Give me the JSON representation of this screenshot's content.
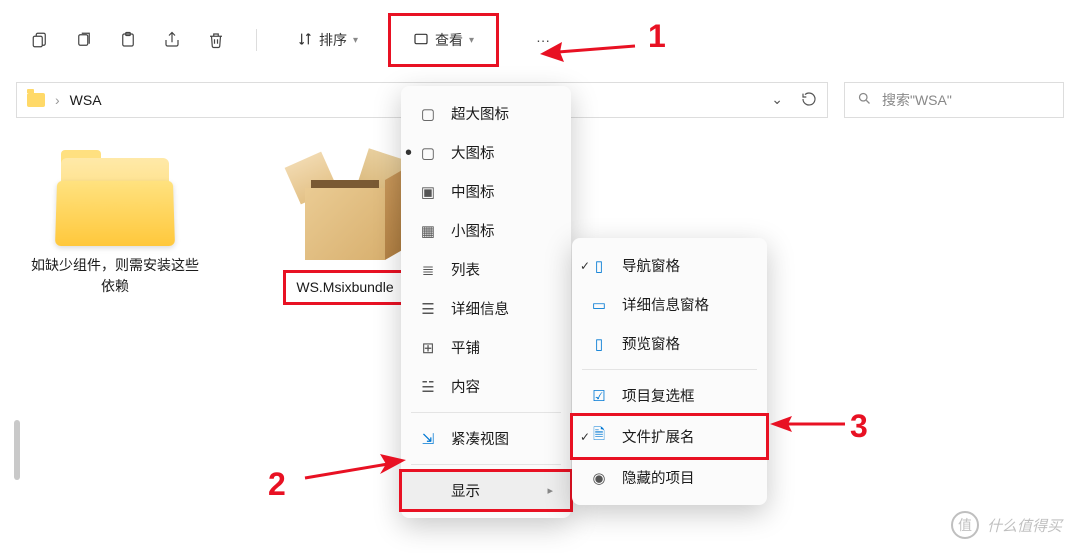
{
  "toolbar": {
    "sort_label": "排序",
    "view_label": "查看"
  },
  "breadcrumb": {
    "path": "WSA"
  },
  "search": {
    "placeholder": "搜索\"WSA\""
  },
  "files": [
    {
      "label": "如缺少组件，则需安装这些依赖"
    },
    {
      "label": "WS.Msixbundle"
    }
  ],
  "view_menu": {
    "items": [
      {
        "label": "超大图标"
      },
      {
        "label": "大图标",
        "selected": true
      },
      {
        "label": "中图标"
      },
      {
        "label": "小图标"
      },
      {
        "label": "列表"
      },
      {
        "label": "详细信息"
      },
      {
        "label": "平铺"
      },
      {
        "label": "内容"
      },
      {
        "label": "紧凑视图"
      }
    ],
    "show_label": "显示"
  },
  "show_menu": {
    "items": [
      {
        "label": "导航窗格",
        "checked": true
      },
      {
        "label": "详细信息窗格"
      },
      {
        "label": "预览窗格"
      },
      {
        "label": "项目复选框"
      },
      {
        "label": "文件扩展名",
        "checked": true
      },
      {
        "label": "隐藏的项目"
      }
    ]
  },
  "annotations": {
    "n1": "1",
    "n2": "2",
    "n3": "3"
  },
  "watermark": {
    "badge": "值",
    "text": "什么值得买"
  }
}
